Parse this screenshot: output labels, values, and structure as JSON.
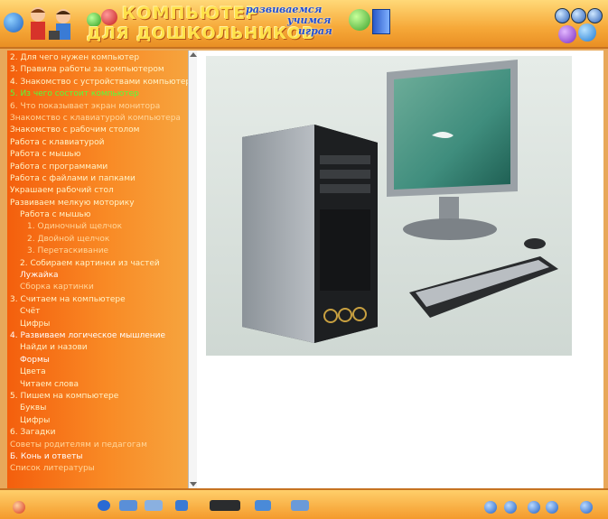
{
  "header": {
    "title_line1": "КОМПЬЮТЕР",
    "title_line2": "ДЛЯ ДОШКОЛЬНИКОВ",
    "slogan1": "развиваемся",
    "slogan2": "учимся",
    "slogan3": "играя"
  },
  "sidebar": {
    "items": [
      {
        "label": "2. Для чего нужен компьютер",
        "level": 0,
        "state": "normal"
      },
      {
        "label": "3. Правила работы за компьютером",
        "level": 0,
        "state": "normal"
      },
      {
        "label": "4. Знакомство с устройствами компьютера",
        "level": 0,
        "state": "normal"
      },
      {
        "label": "5. Из чего состоит компьютер",
        "level": 0,
        "state": "active"
      },
      {
        "label": "6. Что показывает экран монитора",
        "level": 0,
        "state": "dim"
      },
      {
        "label": "Знакомство с клавиатурой компьютера",
        "level": 0,
        "state": "dim"
      },
      {
        "label": "Знакомство с рабочим столом",
        "level": 0,
        "state": "normal"
      },
      {
        "label": "Работа с клавиатурой",
        "level": 0,
        "state": "normal"
      },
      {
        "label": "Работа с мышью",
        "level": 0,
        "state": "normal"
      },
      {
        "label": "Работа с программами",
        "level": 0,
        "state": "normal"
      },
      {
        "label": "Работа с файлами и папками",
        "level": 0,
        "state": "normal"
      },
      {
        "label": "Украшаем рабочий стол",
        "level": 0,
        "state": "normal"
      },
      {
        "label": "Развиваем мелкую моторику",
        "level": 0,
        "state": "normal"
      },
      {
        "label": "Работа с мышью",
        "level": 1,
        "state": "normal"
      },
      {
        "label": "1. Одиночный щелчок",
        "level": 2,
        "state": "dim"
      },
      {
        "label": "2. Двойной щелчок",
        "level": 2,
        "state": "dim"
      },
      {
        "label": "3. Перетаскивание",
        "level": 2,
        "state": "dim"
      },
      {
        "label": "2. Собираем картинки из частей",
        "level": 1,
        "state": "normal"
      },
      {
        "label": "Лужайка",
        "level": 1,
        "state": "bright"
      },
      {
        "label": "Сборка картинки",
        "level": 1,
        "state": "dim"
      },
      {
        "label": "3. Считаем на компьютере",
        "level": 0,
        "state": "normal"
      },
      {
        "label": "Счёт",
        "level": 1,
        "state": "normal"
      },
      {
        "label": "Цифры",
        "level": 1,
        "state": "normal"
      },
      {
        "label": "4. Развиваем логическое мышление",
        "level": 0,
        "state": "bright"
      },
      {
        "label": "Найди и назови",
        "level": 1,
        "state": "normal"
      },
      {
        "label": "Формы",
        "level": 1,
        "state": "bright"
      },
      {
        "label": "Цвета",
        "level": 1,
        "state": "normal"
      },
      {
        "label": "Читаем слова",
        "level": 1,
        "state": "normal"
      },
      {
        "label": "5. Пишем на компьютере",
        "level": 0,
        "state": "normal"
      },
      {
        "label": "Буквы",
        "level": 1,
        "state": "normal"
      },
      {
        "label": "Цифры",
        "level": 1,
        "state": "normal"
      },
      {
        "label": "6. Загадки",
        "level": 0,
        "state": "normal"
      },
      {
        "label": "Советы родителям и педагогам",
        "level": 0,
        "state": "dim"
      },
      {
        "label": "Б. Конь и ответы",
        "level": 0,
        "state": "bright"
      },
      {
        "label": "Список литературы",
        "level": 0,
        "state": "dim"
      }
    ]
  },
  "colors": {
    "sidebar_active": "#54ff3a",
    "title": "#ffe14a",
    "slogan": "#1f4fd6"
  },
  "icons": {
    "header": [
      "globe-icon",
      "children-icon",
      "balls-icon",
      "book-icon",
      "window-controls-icon"
    ],
    "footer": [
      "back-icon",
      "forward-icon",
      "home-icon",
      "exit-icon",
      "toolbar-icons"
    ]
  }
}
